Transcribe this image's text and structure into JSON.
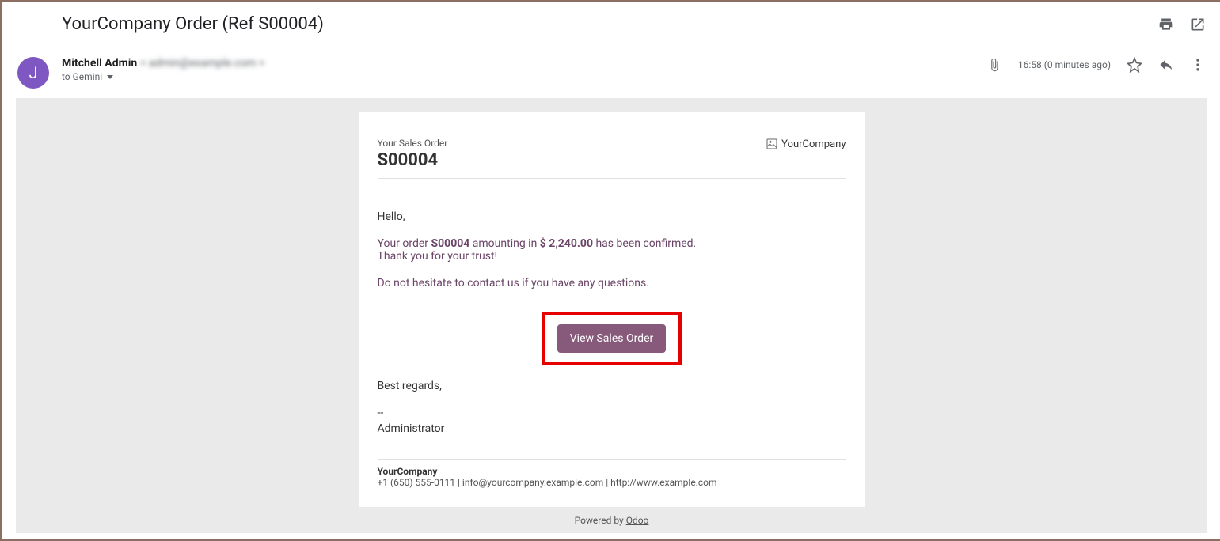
{
  "header": {
    "subject": "YourCompany Order (Ref S00004)"
  },
  "sender": {
    "avatar_letter": "J",
    "name": "Mitchell Admin",
    "email_hidden": "< admin@example.com >",
    "to_line": "to Gemini"
  },
  "meta": {
    "timestamp": "16:58 (0 minutes ago)"
  },
  "email": {
    "label": "Your Sales Order",
    "order_number": "S00004",
    "logo_alt": "YourCompany",
    "greeting": "Hello,",
    "line1_pre": "Your order ",
    "line1_order": "S00004",
    "line1_mid": " amounting in ",
    "line1_amount": "$ 2,240.00",
    "line1_post": " has been confirmed.",
    "line2": "Thank you for your trust!",
    "line3": "Do not hesitate to contact us if you have any questions.",
    "button": "View Sales Order",
    "regards": "Best regards,",
    "dashes": "--",
    "signer": "Administrator",
    "company": "YourCompany",
    "contact": "+1 (650) 555-0111 | info@yourcompany.example.com | http://www.example.com",
    "powered_pre": "Powered by ",
    "powered_link": "Odoo"
  }
}
